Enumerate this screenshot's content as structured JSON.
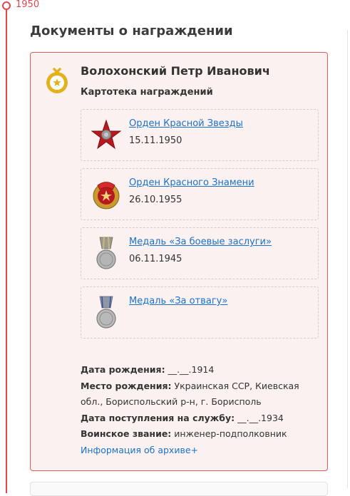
{
  "timeline": {
    "year": "1950"
  },
  "section": {
    "title": "Документы о награждении"
  },
  "person": {
    "name": "Волохонский Петр Иванович"
  },
  "card": {
    "subtitle": "Картотека награждений"
  },
  "awards": [
    {
      "name": "Орден Красной Звезды",
      "date": "15.11.1950",
      "icon": "red-star-order-icon"
    },
    {
      "name": "Орден Красного Знамени",
      "date": "26.10.1955",
      "icon": "red-banner-order-icon"
    },
    {
      "name": "Медаль «За боевые заслуги»",
      "date": "06.11.1945",
      "icon": "combat-merit-medal-icon"
    },
    {
      "name": "Медаль «За отвагу»",
      "date": "",
      "icon": "bravery-medal-icon"
    }
  ],
  "info": {
    "birth_date_label": "Дата рождения:",
    "birth_date_value": "__.__.1914",
    "birth_place_label": "Место рождения:",
    "birth_place_value": "Украинская ССР, Киевская обл., Бориспольский р-н, г. Борисполь",
    "service_date_label": "Дата поступления на службу:",
    "service_date_value": "__.__.1934",
    "rank_label": "Воинское звание:",
    "rank_value": "инженер-подполковник",
    "archive_link": "Информация об архиве+"
  },
  "colors": {
    "accent": "#e3474e",
    "link": "#1a73c7",
    "card_bg": "#fcf1f1",
    "card_border": "#e35a5a",
    "emblem": "#e2b21d"
  }
}
